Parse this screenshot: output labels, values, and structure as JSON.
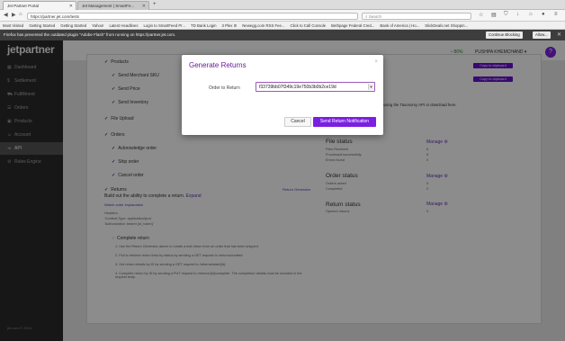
{
  "browser": {
    "tabs": [
      {
        "label": "Jet Partner Portal",
        "active": true
      },
      {
        "label": "Jet Management | SmartFe...",
        "active": false
      }
    ],
    "url": "https://partner.jet.com/tests",
    "search_placeholder": "Search",
    "bookmarks": [
      "Most Visited",
      "Getting Started",
      "Getting Started",
      "Yahoo!",
      "Latest Headlines",
      "Login to SmartFeed Pr...",
      "TD Bank Login",
      "3 Plex It!",
      "Newegg.com RSS Fee...",
      "Click to Call Console",
      "Bethpage Federal Cred...",
      "Bank of America | Ho...",
      "SlickDeals.net Shoppin..."
    ],
    "notification": "Firefox has prevented the outdated plugin \"Adobe Flash\" from running on https://partner.jet.com.",
    "continue_blocking": "Continue Blocking",
    "allow": "Allow..."
  },
  "app": {
    "logo": "jetpartner",
    "sidebar": [
      "Dashboard",
      "Settlement",
      "Fulfillment",
      "Orders",
      "Products",
      "Account",
      "API",
      "Rules Engine"
    ],
    "active_sidebar": "API",
    "copyright": "jet.com © 2016",
    "user": "PUSHPA KHEMCHAND",
    "progress": "80%"
  },
  "left_items": [
    "Send Merchant SKU",
    "Send Price",
    "Send Inventory",
    "File Upload",
    "Orders",
    "Acknowledge order",
    "Ship order",
    "Cancel order",
    "Returns"
  ],
  "top_label": "Products",
  "returns": {
    "desc": "Build out the ability to complete a return.",
    "expand": "Expand",
    "return_generator": "Return Generator",
    "watch_link": "Watch order explanation",
    "headers": [
      "Headers:",
      "'Content-Type: application/json'",
      "'Authorization: bearer {id_token}'"
    ],
    "complete_title": "Complete return",
    "steps": [
      "1. Use the Return Generator above to create a test return from an order that has been shipped.",
      "2. Poll to retrieve return links by status by sending a GET request to /returns/created.",
      "3. Get return details by ID by sending a GET request to /returns/state/{id}.",
      "4. Complete return by ID by sending a PUT request to /returns/{id}/complete. The completion details must be included in the request body."
    ]
  },
  "right_panel": {
    "copy_btn_1": "Copy to clipboard",
    "copy_btn_2": "Copy to clipboard",
    "taxonomy_text": "using the Taxonomy API or download here.",
    "file_status": {
      "title": "File status",
      "manage": "Manage",
      "rows": [
        "Files Received",
        "Processed successfully",
        "Errors found"
      ],
      "values": [
        "6",
        "6",
        "0"
      ]
    },
    "order_status": {
      "title": "Order status",
      "manage": "Manage",
      "rows": [
        "Orders acked",
        "Completed"
      ],
      "values": [
        "0",
        "0"
      ]
    },
    "return_status": {
      "title": "Return status",
      "manage": "Manage",
      "rows": [
        "Opened returns"
      ],
      "values": [
        "0"
      ]
    }
  },
  "modal": {
    "title": "Generate Returns",
    "label": "Order to Return",
    "selected_value": "f33739bb07f349c19e750b3b0b2ce19d",
    "cancel": "Cancel",
    "send": "Send Return Notification"
  }
}
